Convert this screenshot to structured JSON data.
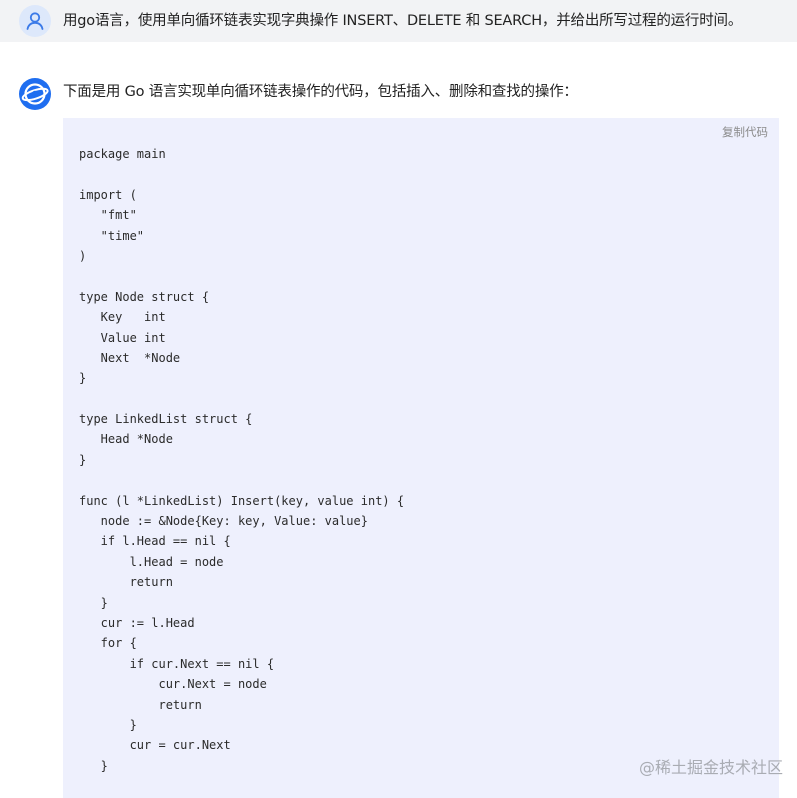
{
  "user_message": {
    "avatar_icon": "user-icon",
    "text": "用go语言，使用单向循环链表实现字典操作 INSERT、DELETE 和 SEARCH，并给出所写过程的运行时间。"
  },
  "bot_message": {
    "avatar_icon": "assistant-logo-icon",
    "text": "下面是用 Go 语言实现单向循环链表操作的代码，包括插入、删除和查找的操作："
  },
  "code_block": {
    "copy_label": "复制代码",
    "lines": [
      "package main",
      "",
      "import (",
      "   \"fmt\"",
      "   \"time\"",
      ")",
      "",
      "type Node struct {",
      "   Key   int",
      "   Value int",
      "   Next  *Node",
      "}",
      "",
      "type LinkedList struct {",
      "   Head *Node",
      "}",
      "",
      "func (l *LinkedList) Insert(key, value int) {",
      "   node := &Node{Key: key, Value: value}",
      "   if l.Head == nil {",
      "       l.Head = node",
      "       return",
      "   }",
      "   cur := l.Head",
      "   for {",
      "       if cur.Next == nil {",
      "           cur.Next = node",
      "           return",
      "       }",
      "       cur = cur.Next",
      "   }"
    ]
  },
  "watermark": "@稀土掘金技术社区",
  "colors": {
    "user_row_bg": "#f2f3f5",
    "code_bg": "#eef0fd",
    "accent": "#1f6ef0"
  }
}
